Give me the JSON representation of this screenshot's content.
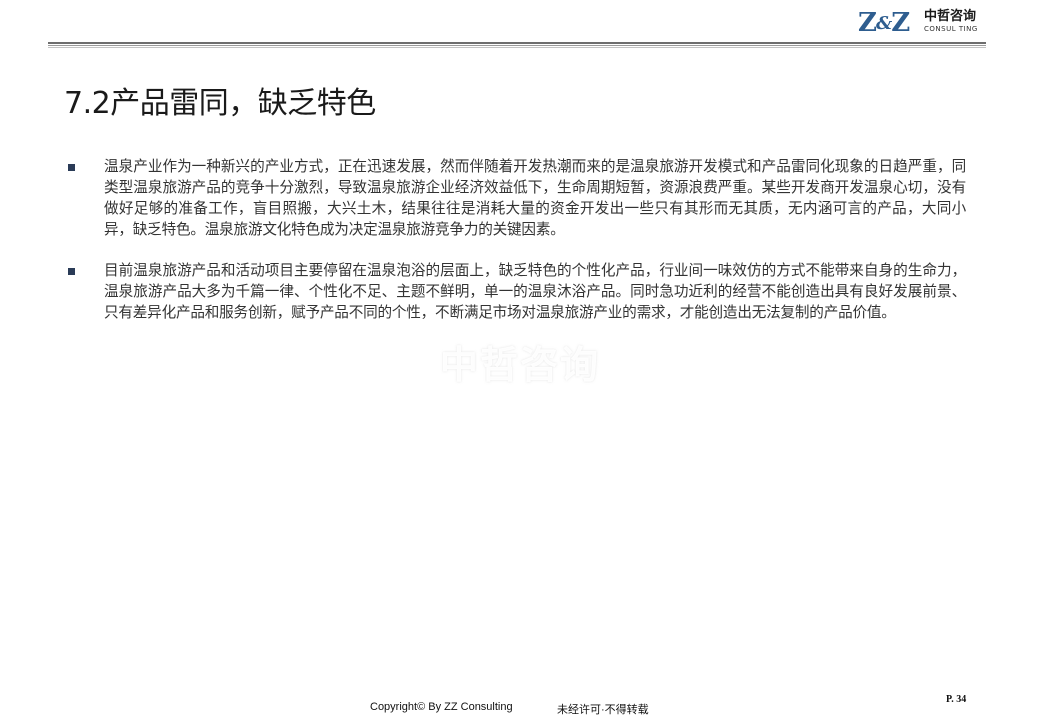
{
  "header": {
    "logo_mark": "Z&Z",
    "logo_mark_left": "Z",
    "logo_mark_amp": "&",
    "logo_mark_right": "Z",
    "logo_cn": "中哲咨询",
    "logo_en": "CONSUL TING"
  },
  "title": "7.2产品雷同，缺乏特色",
  "bullets": [
    {
      "text": "温泉产业作为一种新兴的产业方式，正在迅速发展，然而伴随着开发热潮而来的是温泉旅游开发模式和产品雷同化现象的日趋严重，同类型温泉旅游产品的竞争十分激烈，导致温泉旅游企业经济效益低下，生命周期短暂，资源浪费严重。某些开发商开发温泉心切，没有做好足够的准备工作，盲目照搬，大兴土木，结果往往是消耗大量的资金开发出一些只有其形而无其质，无内涵可言的产品，大同小异，缺乏特色。温泉旅游文化特色成为决定温泉旅游竞争力的关键因素。"
    },
    {
      "text": "目前温泉旅游产品和活动项目主要停留在温泉泡浴的层面上，缺乏特色的个性化产品，行业间一味效仿的方式不能带来自身的生命力，温泉旅游产品大多为千篇一律、个性化不足、主题不鲜明，单一的温泉沐浴产品。同时急功近利的经营不能创造出具有良好发展前景、只有差异化产品和服务创新，赋予产品不同的个性，不断满足市场对温泉旅游产业的需求，才能创造出无法复制的产品价值。"
    }
  ],
  "watermark": "中哲咨询",
  "footer": {
    "copyright": "Copyright© By  ZZ Consulting",
    "notice": "未经许可·不得转载",
    "page": "P. 34"
  },
  "colors": {
    "logo_blue": "#2e5d8f",
    "bullet_marker": "#2a3b57",
    "body_text": "#333333"
  }
}
